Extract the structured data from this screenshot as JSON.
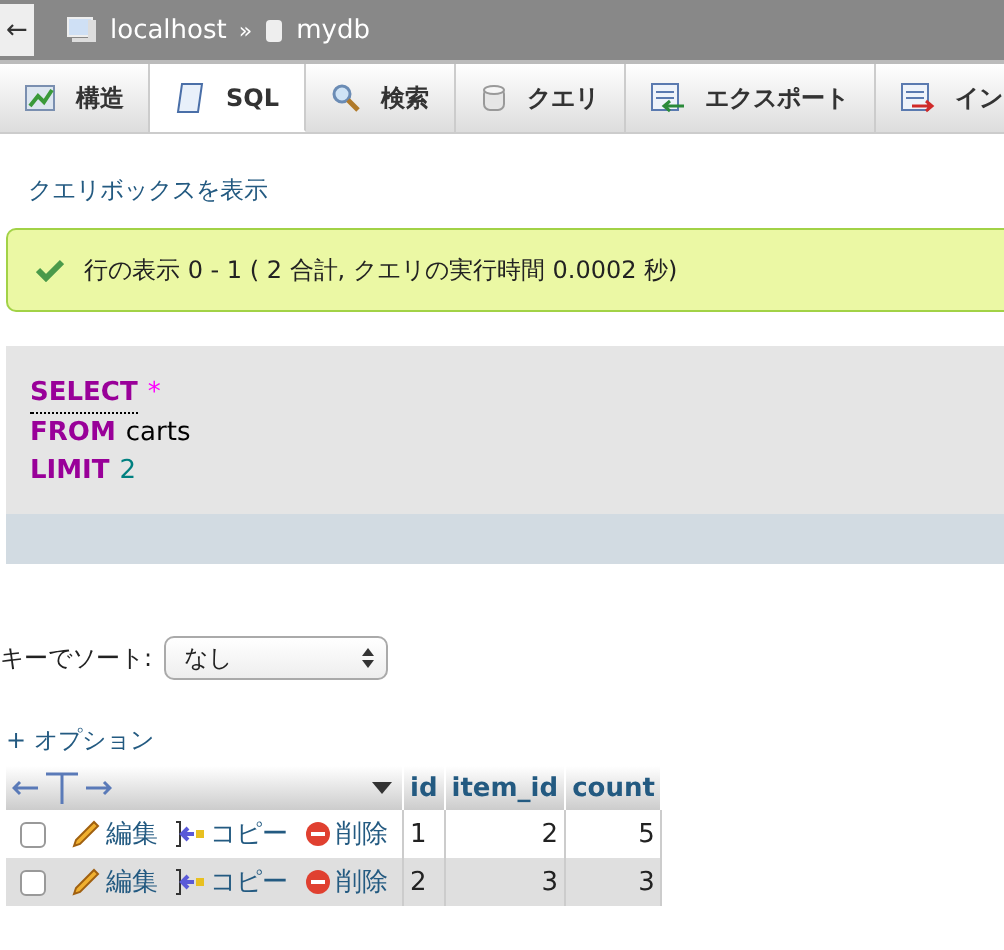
{
  "breadcrumb": {
    "back": "←",
    "server": "localhost",
    "separator": "»",
    "database": "mydb"
  },
  "tabs": [
    {
      "label": "構造",
      "selected": false
    },
    {
      "label": "SQL",
      "selected": true
    },
    {
      "label": "検索",
      "selected": false
    },
    {
      "label": "クエリ",
      "selected": false
    },
    {
      "label": "エクスポート",
      "selected": false
    },
    {
      "label": "イン",
      "selected": false
    }
  ],
  "show_query_box": "クエリボックスを表示",
  "success_message": "行の表示 0 - 1 ( 2 合計, クエリの実行時間 0.0002 秒)",
  "sql": [
    [
      {
        "kind": "keyword",
        "text": "SELECT"
      },
      {
        "kind": "star",
        "text": "*"
      }
    ],
    [
      {
        "kind": "keyword",
        "text": "FROM"
      },
      {
        "kind": "text",
        "text": "carts"
      }
    ],
    [
      {
        "kind": "keyword",
        "text": "LIMIT"
      },
      {
        "kind": "number",
        "text": "2"
      }
    ]
  ],
  "sort": {
    "label": "キーでソート:",
    "value": "なし"
  },
  "options_link": "+ オプション",
  "table": {
    "columns": [
      "id",
      "item_id",
      "count"
    ],
    "rows": [
      {
        "checked": false,
        "edit": "編集",
        "copy": "コピー",
        "delete": "削除",
        "cells": [
          "1",
          "2",
          "5"
        ]
      },
      {
        "checked": false,
        "edit": "編集",
        "copy": "コピー",
        "delete": "削除",
        "cells": [
          "2",
          "3",
          "3"
        ]
      }
    ]
  }
}
